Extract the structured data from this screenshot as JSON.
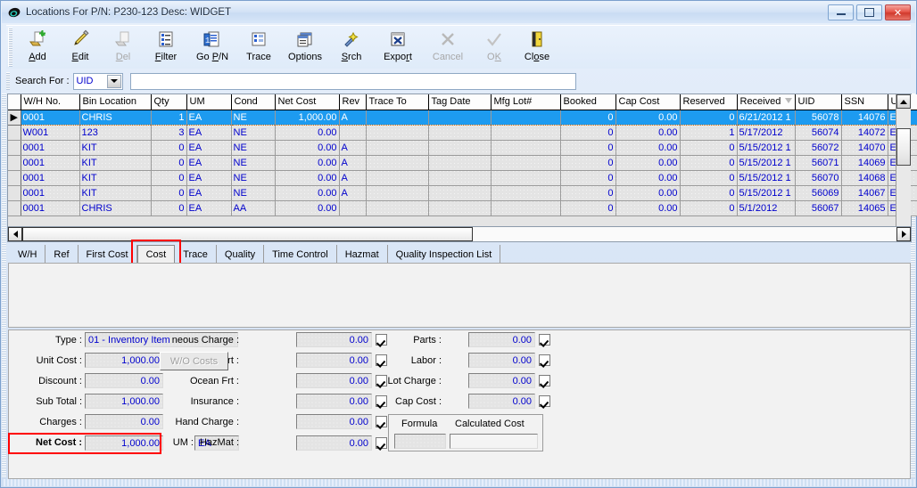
{
  "window": {
    "title": "Locations For P/N: P230-123   Desc: WIDGET",
    "minimize_label": "minimize",
    "maximize_label": "maximize",
    "close_label": "✕"
  },
  "toolbar": {
    "buttons": [
      {
        "label": "Add",
        "icon": "add-document-icon",
        "accel": "A",
        "disabled": false
      },
      {
        "label": "Edit",
        "icon": "pencil-icon",
        "accel": "E",
        "disabled": false
      },
      {
        "label": "Del",
        "icon": "delete-document-icon",
        "accel": "D",
        "disabled": true
      },
      {
        "label": "Filter",
        "icon": "filter-list-icon",
        "accel": "F",
        "disabled": false
      },
      {
        "label": "Go P/N",
        "icon": "goto-part-icon",
        "accel": "P",
        "disabled": false
      },
      {
        "label": "Trace",
        "icon": "trace-list-icon",
        "accel": "",
        "disabled": false
      },
      {
        "label": "Options",
        "icon": "options-window-icon",
        "accel": "",
        "disabled": false
      },
      {
        "label": "Srch",
        "icon": "search-wand-icon",
        "accel": "S",
        "disabled": false
      },
      {
        "label": "Export",
        "icon": "export-excel-icon",
        "accel": "r",
        "disabled": false
      },
      {
        "label": "Cancel",
        "icon": "cancel-x-icon",
        "accel": "",
        "disabled": true
      },
      {
        "label": "OK",
        "icon": "ok-check-icon",
        "accel": "K",
        "disabled": true
      },
      {
        "label": "Close",
        "icon": "close-door-icon",
        "accel": "o",
        "disabled": false
      }
    ]
  },
  "search": {
    "label": "Search For :",
    "field_value": "UID",
    "text_value": "",
    "placeholder": ""
  },
  "grid": {
    "columns": [
      {
        "key": "wh",
        "label": "W/H No.",
        "align": "left"
      },
      {
        "key": "bin",
        "label": "Bin Location",
        "align": "left"
      },
      {
        "key": "qty",
        "label": "Qty",
        "align": "right"
      },
      {
        "key": "um",
        "label": "UM",
        "align": "left"
      },
      {
        "key": "cond",
        "label": "Cond",
        "align": "left"
      },
      {
        "key": "netcost",
        "label": "Net Cost",
        "align": "right"
      },
      {
        "key": "rev",
        "label": "Rev",
        "align": "left"
      },
      {
        "key": "traceto",
        "label": "Trace To",
        "align": "left"
      },
      {
        "key": "tagdate",
        "label": "Tag Date",
        "align": "left"
      },
      {
        "key": "mfglot",
        "label": "Mfg Lot#",
        "align": "left"
      },
      {
        "key": "booked",
        "label": "Booked",
        "align": "right"
      },
      {
        "key": "capcost",
        "label": "Cap Cost",
        "align": "right"
      },
      {
        "key": "reserved",
        "label": "Reserved",
        "align": "right"
      },
      {
        "key": "received",
        "label": "Received",
        "align": "left",
        "sort": "desc"
      },
      {
        "key": "uid",
        "label": "UID",
        "align": "right"
      },
      {
        "key": "ssn",
        "label": "SSN",
        "align": "right"
      },
      {
        "key": "um2",
        "label": "UM",
        "align": "left"
      }
    ],
    "rows": [
      {
        "marker": "▶",
        "selected": true,
        "wh": "0001",
        "bin": "CHRIS",
        "qty": "1",
        "um": "EA",
        "cond": "NE",
        "netcost": "1,000.00",
        "rev": "A",
        "traceto": "",
        "tagdate": "",
        "mfglot": "",
        "booked": "0",
        "capcost": "0.00",
        "reserved": "0",
        "received": "6/21/2012 1",
        "uid": "56078",
        "ssn": "14076",
        "um2": "EA"
      },
      {
        "marker": "",
        "selected": false,
        "wh": "W001",
        "bin": "123",
        "qty": "3",
        "um": "EA",
        "cond": "NE",
        "netcost": "0.00",
        "rev": "",
        "traceto": "",
        "tagdate": "",
        "mfglot": "",
        "booked": "0",
        "capcost": "0.00",
        "reserved": "1",
        "received": "5/17/2012",
        "uid": "56074",
        "ssn": "14072",
        "um2": "EA"
      },
      {
        "marker": "",
        "selected": false,
        "wh": "0001",
        "bin": "KIT",
        "qty": "0",
        "um": "EA",
        "cond": "NE",
        "netcost": "0.00",
        "rev": "A",
        "traceto": "",
        "tagdate": "",
        "mfglot": "",
        "booked": "0",
        "capcost": "0.00",
        "reserved": "0",
        "received": "5/15/2012 1",
        "uid": "56072",
        "ssn": "14070",
        "um2": "EA"
      },
      {
        "marker": "",
        "selected": false,
        "wh": "0001",
        "bin": "KIT",
        "qty": "0",
        "um": "EA",
        "cond": "NE",
        "netcost": "0.00",
        "rev": "A",
        "traceto": "",
        "tagdate": "",
        "mfglot": "",
        "booked": "0",
        "capcost": "0.00",
        "reserved": "0",
        "received": "5/15/2012 1",
        "uid": "56071",
        "ssn": "14069",
        "um2": "EA"
      },
      {
        "marker": "",
        "selected": false,
        "wh": "0001",
        "bin": "KIT",
        "qty": "0",
        "um": "EA",
        "cond": "NE",
        "netcost": "0.00",
        "rev": "A",
        "traceto": "",
        "tagdate": "",
        "mfglot": "",
        "booked": "0",
        "capcost": "0.00",
        "reserved": "0",
        "received": "5/15/2012 1",
        "uid": "56070",
        "ssn": "14068",
        "um2": "EA"
      },
      {
        "marker": "",
        "selected": false,
        "wh": "0001",
        "bin": "KIT",
        "qty": "0",
        "um": "EA",
        "cond": "NE",
        "netcost": "0.00",
        "rev": "A",
        "traceto": "",
        "tagdate": "",
        "mfglot": "",
        "booked": "0",
        "capcost": "0.00",
        "reserved": "0",
        "received": "5/15/2012 1",
        "uid": "56069",
        "ssn": "14067",
        "um2": "EA"
      },
      {
        "marker": "",
        "selected": false,
        "wh": "0001",
        "bin": "CHRIS",
        "qty": "0",
        "um": "EA",
        "cond": "AA",
        "netcost": "0.00",
        "rev": "",
        "traceto": "",
        "tagdate": "",
        "mfglot": "",
        "booked": "0",
        "capcost": "0.00",
        "reserved": "0",
        "received": "5/1/2012",
        "uid": "56067",
        "ssn": "14065",
        "um2": "EA"
      }
    ]
  },
  "tabs": {
    "items": [
      {
        "label": "W/H",
        "active": false
      },
      {
        "label": "Ref",
        "active": false
      },
      {
        "label": "First Cost",
        "active": false
      },
      {
        "label": "Cost",
        "active": true
      },
      {
        "label": "Trace",
        "active": false
      },
      {
        "label": "Quality",
        "active": false
      },
      {
        "label": "Time Control",
        "active": false
      },
      {
        "label": "Hazmat",
        "active": false
      },
      {
        "label": "Quality Inspection List",
        "active": false
      }
    ],
    "highlight_color": "#ff0000"
  },
  "form": {
    "left": [
      {
        "label": "Type :",
        "value": "01 - Inventory Item",
        "align": "left"
      },
      {
        "label": "Unit Cost :",
        "value": "1,000.00",
        "align": "right"
      },
      {
        "label": "Discount :",
        "value": "0.00",
        "align": "right"
      },
      {
        "label": "Sub Total :",
        "value": "1,000.00",
        "align": "right"
      },
      {
        "label": "Charges :",
        "value": "0.00",
        "align": "right"
      },
      {
        "label": "Net Cost :",
        "value": "1,000.00",
        "align": "right"
      }
    ],
    "wo_costs_button": "W/O Costs",
    "um_label": "UM :",
    "um_value": "EA",
    "middle": [
      {
        "label": "neous Charge :",
        "value": "0.00",
        "checked": true
      },
      {
        "label": "Air Frt :",
        "value": "0.00",
        "checked": true
      },
      {
        "label": "Ocean Frt :",
        "value": "0.00",
        "checked": true
      },
      {
        "label": "Insurance :",
        "value": "0.00",
        "checked": true
      },
      {
        "label": "Hand Charge :",
        "value": "0.00",
        "checked": true
      },
      {
        "label": "HazMat :",
        "value": "0.00",
        "checked": true
      }
    ],
    "right": [
      {
        "label": "Parts :",
        "value": "0.00",
        "checked": true
      },
      {
        "label": "Labor :",
        "value": "0.00",
        "checked": true
      },
      {
        "label": "Lot Charge :",
        "value": "0.00",
        "checked": true
      },
      {
        "label": "Cap Cost :",
        "value": "0.00",
        "checked": true
      }
    ],
    "formula_label": "Formula",
    "calculated_cost_label": "Calculated Cost",
    "formula_value": "",
    "calculated_cost_value": "",
    "net_cost_highlight_color": "#ff0000"
  }
}
